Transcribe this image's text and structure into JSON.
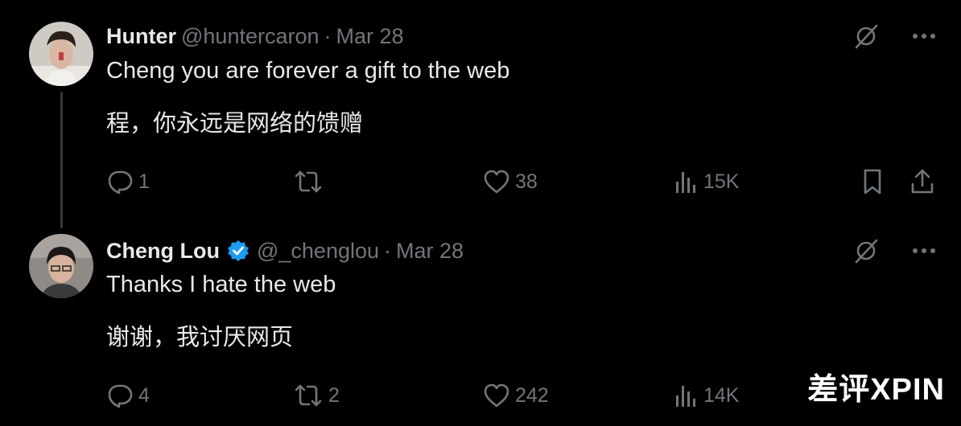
{
  "tweets": [
    {
      "name": "Hunter",
      "handle": "@huntercaron",
      "separator": "·",
      "date": "Mar 28",
      "verified": false,
      "text_en": "Cheng you are forever a gift to the web",
      "text_zh": "程，你永远是网络的馈赠",
      "replies": "1",
      "retweets": "",
      "likes": "38",
      "views": "15K"
    },
    {
      "name": "Cheng Lou",
      "handle": "@_chenglou",
      "separator": "·",
      "date": "Mar 28",
      "verified": true,
      "text_en": "Thanks I hate the web",
      "text_zh": "谢谢，我讨厌网页",
      "replies": "4",
      "retweets": "2",
      "likes": "242",
      "views": "14K"
    }
  ],
  "watermark": "差评XPIN",
  "colors": {
    "background": "#000000",
    "text": "#e7e9ea",
    "muted": "#71767b",
    "verified": "#1d9bf0",
    "thread_line": "#333639"
  },
  "icons": {
    "reply": "speech-bubble-icon",
    "retweet": "retweet-icon",
    "like": "heart-icon",
    "views": "bar-chart-icon",
    "bookmark": "bookmark-icon",
    "share": "share-icon",
    "grok": "grok-icon",
    "more": "more-dots-icon",
    "verified": "verified-badge-icon"
  }
}
